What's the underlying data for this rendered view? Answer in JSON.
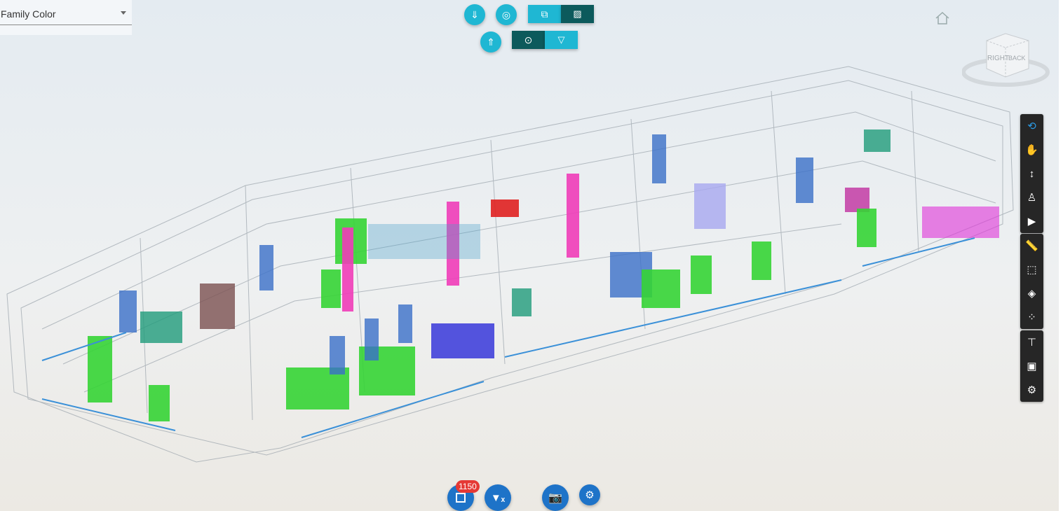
{
  "dropdown": {
    "label": "Family Color"
  },
  "top_toolbar": {
    "buttons": [
      {
        "icon": "arrow-down-icon",
        "color": "#1fb7d3"
      },
      {
        "icon": "crosshair-icon",
        "color": "#1fb7d3"
      },
      {
        "icon": "copy-select-icon",
        "color": "#1fb7d3"
      },
      {
        "icon": "hatch-icon",
        "color": "#0c5a5c"
      },
      {
        "icon": "arrow-up-icon",
        "color": "#1fb7d3"
      },
      {
        "icon": "record-icon",
        "color": "#0c5a5c"
      },
      {
        "icon": "filter-icon",
        "color": "#1fb7d3"
      }
    ]
  },
  "viewcube": {
    "faces": [
      "RIGHT",
      "BACK"
    ]
  },
  "side_toolbar": {
    "groups": [
      [
        "orbit-icon",
        "pan-icon",
        "zoom-icon",
        "first-person-icon",
        "camera-icon"
      ],
      [
        "measure-icon",
        "section-icon",
        "explode-icon",
        "model-browser-icon"
      ],
      [
        "structure-icon",
        "properties-icon",
        "settings-icon"
      ]
    ],
    "active_color": "#2b9be6"
  },
  "bottom_toolbar": {
    "selection_count": "1150",
    "badge_color": "#e53935",
    "button_color": "#1e73c8"
  }
}
